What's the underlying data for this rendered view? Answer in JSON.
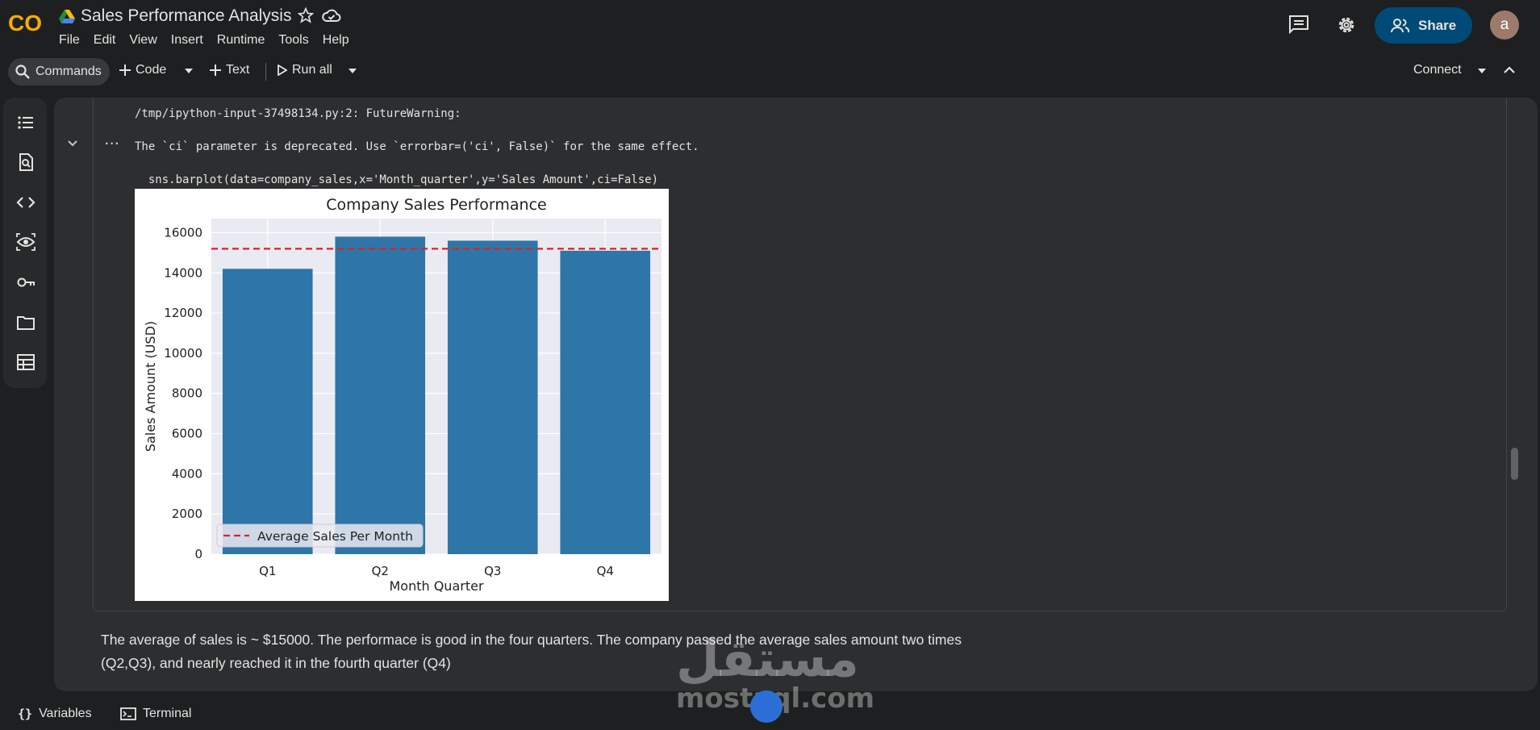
{
  "header": {
    "title": "Sales Performance Analysis",
    "menus": [
      "File",
      "Edit",
      "View",
      "Insert",
      "Runtime",
      "Tools",
      "Help"
    ],
    "share_label": "Share",
    "avatar_letter": "a",
    "logo_text": "CO"
  },
  "toolbar": {
    "commands_label": "Commands",
    "code_label": "Code",
    "text_label": "Text",
    "run_all_label": "Run all",
    "connect_label": "Connect"
  },
  "rail_icons": [
    "toc-icon",
    "find-icon",
    "code-snippets-icon",
    "variables-inspector-icon",
    "secrets-key-icon",
    "files-folder-icon",
    "data-table-icon"
  ],
  "output": {
    "warning_line1": "/tmp/ipython-input-37498134.py:2: FutureWarning:",
    "warning_line2": "The `ci` parameter is deprecated. Use `errorbar=('ci', False)` for the same effect.",
    "warning_line3": "  sns.barplot(data=company_sales,x='Month_quarter',y='Sales Amount',ci=False)"
  },
  "chart_data": {
    "type": "bar",
    "title": "Company Sales Performance",
    "xlabel": "Month Quarter",
    "ylabel": "Sales Amount (USD)",
    "categories": [
      "Q1",
      "Q2",
      "Q3",
      "Q4"
    ],
    "values": [
      14200,
      15800,
      15600,
      15100
    ],
    "ylim": [
      0,
      16700
    ],
    "yticks": [
      0,
      2000,
      4000,
      6000,
      8000,
      10000,
      12000,
      14000,
      16000
    ],
    "average_line": 15200,
    "legend": "Average Sales Per Month",
    "legend_position": "lower left",
    "bar_color": "#2e75a8",
    "avg_color": "#e02020",
    "plot_bg": "#eaeaf2",
    "grid": true
  },
  "markdown": {
    "line1": "The average of sales is ~ $15000. The performace is good in the four quarters. The company passed the average sales amount two times",
    "line2": "(Q2,Q3), and nearly reached it in the fourth quarter (Q4)"
  },
  "bottom": {
    "variables_label": "Variables",
    "terminal_label": "Terminal"
  },
  "watermark": {
    "arabic": "مستقل",
    "url": "mostaql.com"
  }
}
